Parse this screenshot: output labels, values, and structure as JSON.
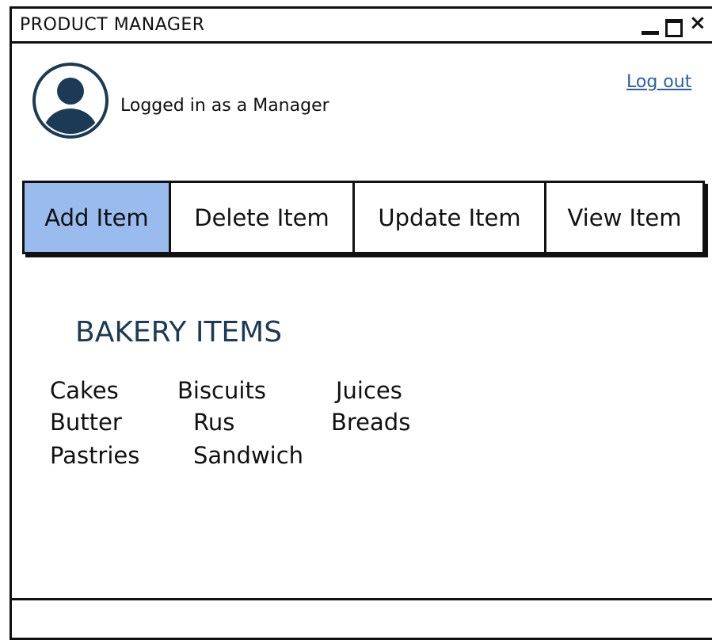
{
  "window": {
    "title": "PRODUCT MANAGER",
    "icons": {
      "minimize": "minimize-icon",
      "maximize": "maximize-icon",
      "close": "close-icon",
      "close_glyph": "×"
    }
  },
  "user": {
    "avatar_icon": "user-avatar-icon",
    "status_text": "Logged in as a Manager",
    "logout_label": "Log out"
  },
  "tabs": [
    {
      "label": "Add Item",
      "active": true
    },
    {
      "label": "Delete Item",
      "active": false
    },
    {
      "label": "Update Item",
      "active": false
    },
    {
      "label": "View Item",
      "active": false
    }
  ],
  "section": {
    "title": "BAKERY ITEMS",
    "items": [
      "Cakes",
      "Biscuits",
      "Juices",
      "Butter",
      "Rus",
      "Breads",
      "Pastries",
      "Sandwich"
    ]
  },
  "colors": {
    "active_tab": "#99bbee",
    "link": "#2a5da8",
    "avatar": "#1c3a55",
    "heading": "#1c3a55"
  }
}
